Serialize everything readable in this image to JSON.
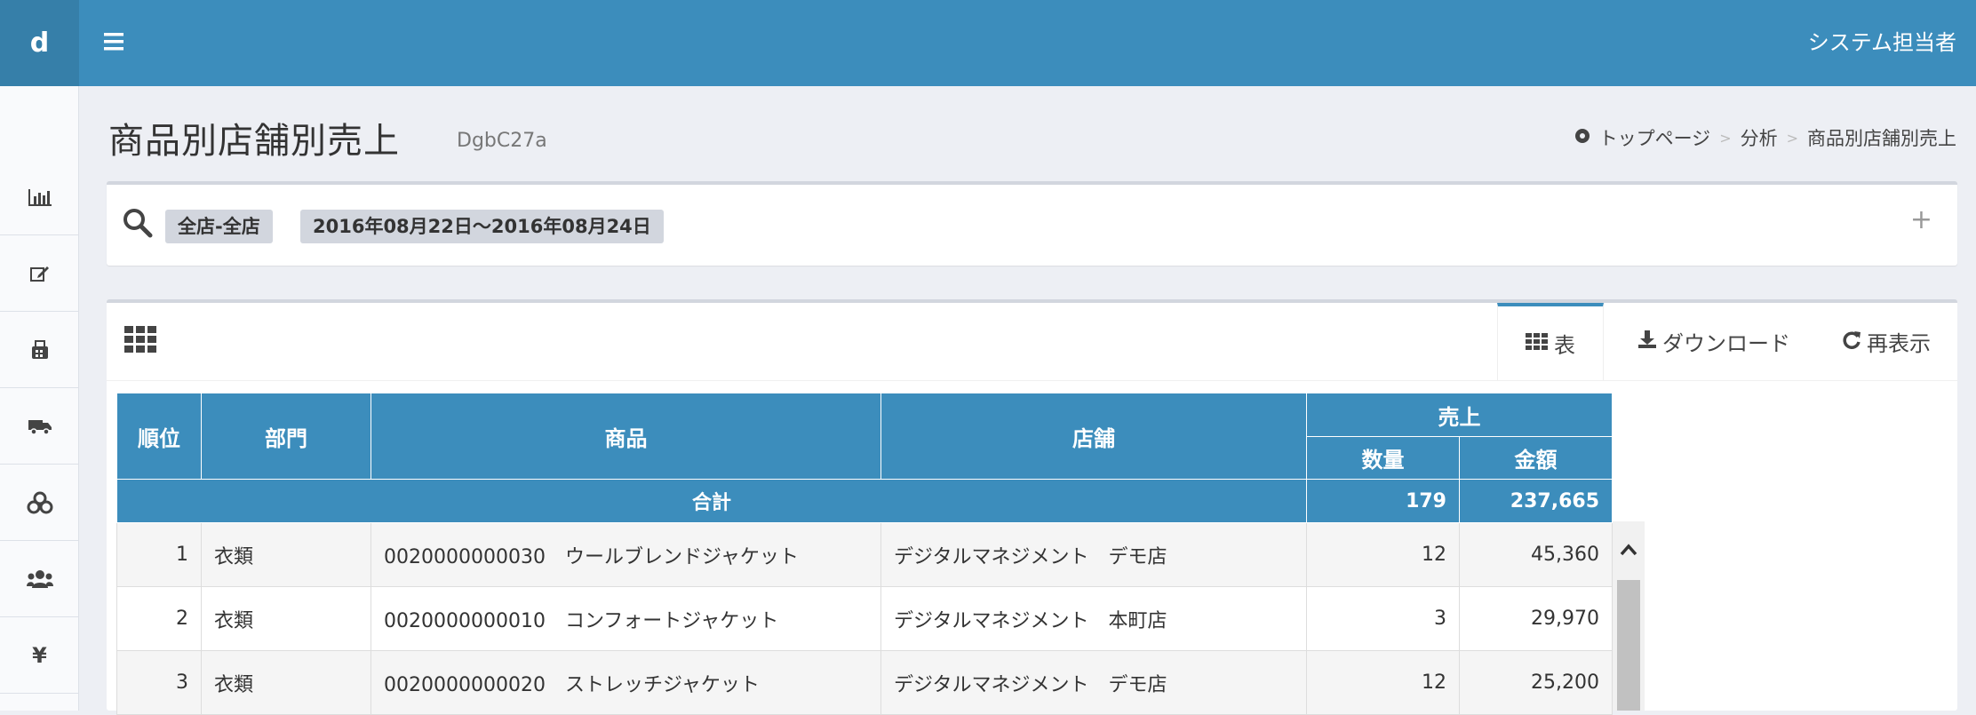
{
  "app": {
    "logo": "d",
    "user": "システム担当者"
  },
  "page": {
    "title": "商品別店舗別売上",
    "subtitle": "DgbC27a"
  },
  "breadcrumb": {
    "home": "トップページ",
    "section": "分析",
    "current": "商品別店舗別売上"
  },
  "filter": {
    "store_tag": "全店-全店",
    "date_tag": "2016年08月22日～2016年08月24日"
  },
  "tabs": {
    "table": "表",
    "download": "ダウンロード",
    "refresh": "再表示"
  },
  "table": {
    "headers": {
      "rank": "順位",
      "dept": "部門",
      "product": "商品",
      "store": "店舗",
      "sales": "売上",
      "qty": "数量",
      "amount": "金額"
    },
    "total": {
      "label": "合計",
      "qty": "179",
      "amount": "237,665"
    },
    "rows": [
      {
        "rank": "1",
        "dept": "衣類",
        "product": "0020000000030　ウールブレンドジャケット",
        "store": "デジタルマネジメント　デモ店",
        "qty": "12",
        "amount": "45,360"
      },
      {
        "rank": "2",
        "dept": "衣類",
        "product": "0020000000010　コンフォートジャケット",
        "store": "デジタルマネジメント　本町店",
        "qty": "3",
        "amount": "29,970"
      },
      {
        "rank": "3",
        "dept": "衣類",
        "product": "0020000000020　ストレッチジャケット",
        "store": "デジタルマネジメント　デモ店",
        "qty": "12",
        "amount": "25,200"
      }
    ]
  },
  "sidebar": {
    "items": [
      "bar-chart-icon",
      "edit-icon",
      "register-icon",
      "truck-icon",
      "cubes-icon",
      "users-icon",
      "yen-icon"
    ],
    "yen": "¥"
  },
  "colors": {
    "primary": "#3c8dbc",
    "logo_bg": "#367fa9",
    "content_bg": "#edeff4"
  }
}
